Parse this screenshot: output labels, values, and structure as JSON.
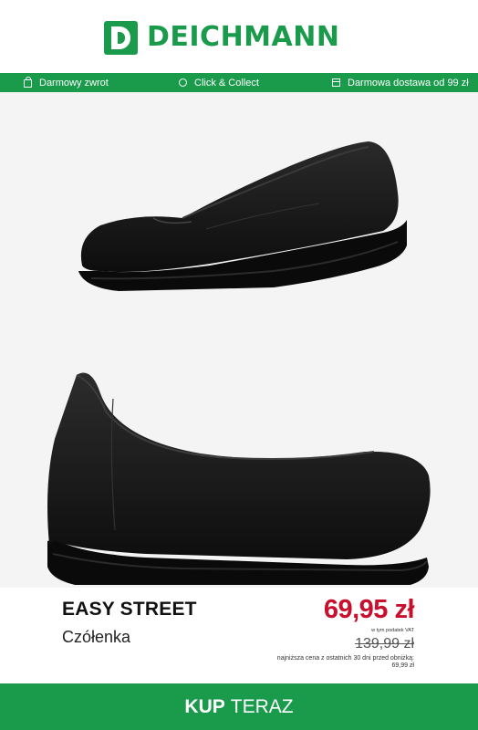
{
  "header": {
    "logo_text": "DEICHMANN",
    "brand_color": "#1a9a4b"
  },
  "service_bar": {
    "items": [
      {
        "icon": "shopping-bag-icon",
        "label": "Darmowy zwrot"
      },
      {
        "icon": "location-pin-icon",
        "label": "Click & Collect"
      },
      {
        "icon": "delivery-box-icon",
        "label": "Darmowa dostawa od 99 zł"
      }
    ]
  },
  "product": {
    "brand": "EASY STREET",
    "category": "Czółenka",
    "price": "69,95 zł",
    "vat_note": "w tym podatek VAT",
    "old_price": "139,99 zł",
    "lowest_price_label": "najniższa cena z ostatnich 30 dni przed obniżką:",
    "lowest_price_value": "69,99 zł",
    "price_color": "#c8102e"
  },
  "cta": {
    "bold": "KUP",
    "rest": "TERAZ"
  }
}
